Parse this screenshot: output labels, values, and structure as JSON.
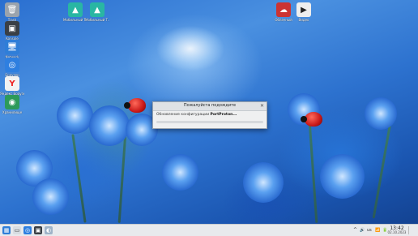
{
  "desktop": {
    "icons": [
      {
        "label": "Trash",
        "glyph": "🗑",
        "color": "#9aa3ad"
      },
      {
        "label": "Konsole",
        "glyph": "▣",
        "color": "#3a3f45"
      },
      {
        "label": "Network",
        "glyph": "🖥",
        "color": "#2f7ed8"
      },
      {
        "label": "Браузер",
        "glyph": "◎",
        "color": "#2e7fe0"
      },
      {
        "label": "Яндекс Браузер",
        "glyph": "Y",
        "color": "#f2f2f2"
      },
      {
        "label": "Хранилище",
        "glyph": "◉",
        "color": "#2d9a5a"
      },
      {
        "label": "Мобильный Т...",
        "glyph": "▲",
        "color": "#29b6a3"
      },
      {
        "label": "Мобильный Т...",
        "glyph": "▲",
        "color": "#29b6a3"
      },
      {
        "label": "Облачный",
        "glyph": "☁",
        "color": "#c33"
      },
      {
        "label": "Видео",
        "glyph": "▶",
        "color": "#eee"
      }
    ]
  },
  "dialog": {
    "title": "Пожалуйста подождите",
    "message_prefix": "Обновление конфигурации ",
    "message_app": "PortProton...",
    "close_glyph": "✕"
  },
  "taskbar": {
    "tray_items": [
      "^",
      "🔊",
      "US",
      "📶",
      "🔋"
    ],
    "layout": "us",
    "time": "13:42",
    "date": "02.10.2023"
  }
}
